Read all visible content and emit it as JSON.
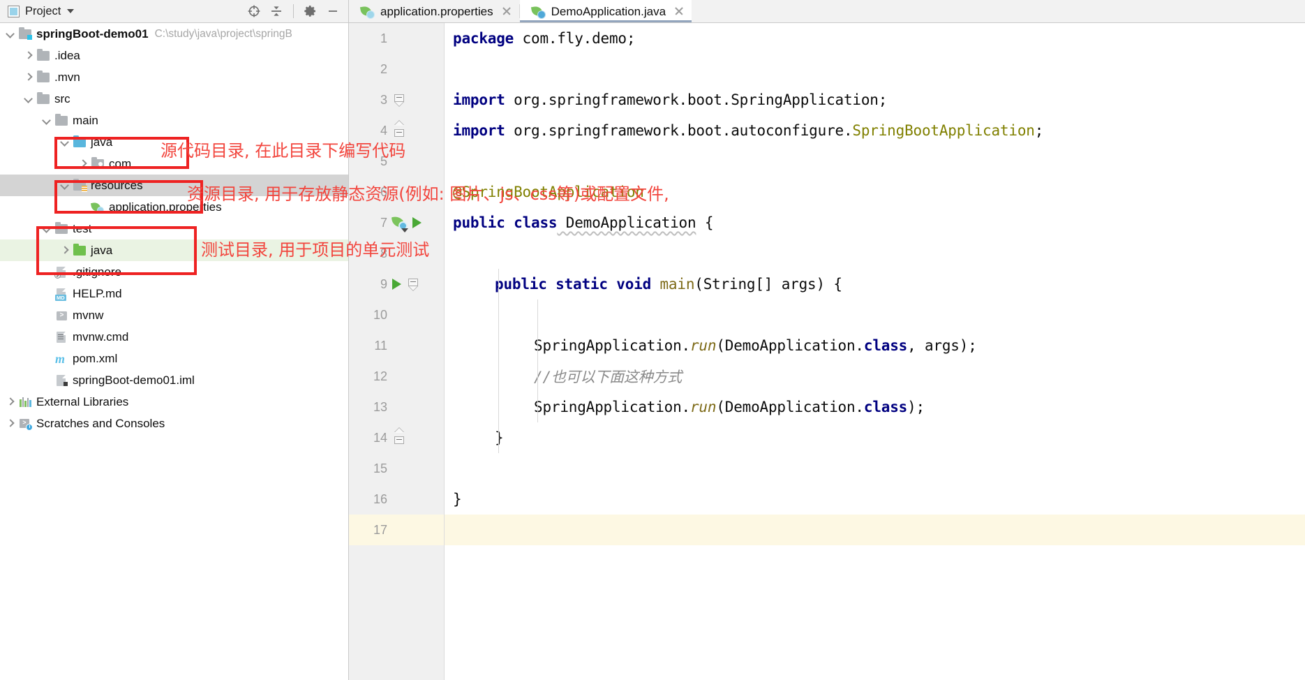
{
  "toolbar": {
    "title": "Project",
    "icons": {
      "project": "project-window-icon",
      "caret": "chevron-down-icon",
      "locate": "locate-target-icon",
      "collapse": "collapse-all-icon",
      "settings": "gear-icon",
      "hide": "minimize-icon"
    }
  },
  "tree": [
    {
      "indent": 0,
      "arrow": "down",
      "icon": "folder-module",
      "label": "springBoot-demo01",
      "bold": true,
      "path": "C:\\study\\java\\project\\springB",
      "state": "normal"
    },
    {
      "indent": 1,
      "arrow": "right",
      "icon": "folder-gray",
      "label": ".idea",
      "bold": false,
      "path": "",
      "state": "normal"
    },
    {
      "indent": 1,
      "arrow": "right",
      "icon": "folder-gray",
      "label": ".mvn",
      "bold": false,
      "path": "",
      "state": "normal"
    },
    {
      "indent": 1,
      "arrow": "down",
      "icon": "folder-gray",
      "label": "src",
      "bold": false,
      "path": "",
      "state": "normal"
    },
    {
      "indent": 2,
      "arrow": "down",
      "icon": "folder-gray",
      "label": "main",
      "bold": false,
      "path": "",
      "state": "normal"
    },
    {
      "indent": 3,
      "arrow": "down",
      "icon": "folder-source",
      "label": "java",
      "bold": false,
      "path": "",
      "state": "normal"
    },
    {
      "indent": 4,
      "arrow": "right",
      "icon": "folder-pkg",
      "label": "com",
      "bold": false,
      "path": "",
      "state": "normal"
    },
    {
      "indent": 3,
      "arrow": "down",
      "icon": "folder-res",
      "label": "resources",
      "bold": false,
      "path": "",
      "state": "selected"
    },
    {
      "indent": 4,
      "arrow": "none",
      "icon": "spring-file",
      "label": "application.properties",
      "bold": false,
      "path": "",
      "state": "normal"
    },
    {
      "indent": 2,
      "arrow": "down",
      "icon": "folder-gray",
      "label": "test",
      "bold": false,
      "path": "",
      "state": "normal"
    },
    {
      "indent": 3,
      "arrow": "right",
      "icon": "folder-test",
      "label": "java",
      "bold": false,
      "path": "",
      "state": "test-highlight"
    },
    {
      "indent": 2,
      "arrow": "none",
      "icon": "file-gitignore",
      "label": ".gitignore",
      "bold": false,
      "path": "",
      "state": "normal"
    },
    {
      "indent": 2,
      "arrow": "none",
      "icon": "file-md",
      "label": "HELP.md",
      "bold": false,
      "path": "",
      "state": "normal"
    },
    {
      "indent": 2,
      "arrow": "none",
      "icon": "file-sh",
      "label": "mvnw",
      "bold": false,
      "path": "",
      "state": "normal"
    },
    {
      "indent": 2,
      "arrow": "none",
      "icon": "file-cmd",
      "label": "mvnw.cmd",
      "bold": false,
      "path": "",
      "state": "normal"
    },
    {
      "indent": 2,
      "arrow": "none",
      "icon": "file-maven",
      "label": "pom.xml",
      "bold": false,
      "path": "",
      "state": "normal"
    },
    {
      "indent": 2,
      "arrow": "none",
      "icon": "file-iml",
      "label": "springBoot-demo01.iml",
      "bold": false,
      "path": "",
      "state": "normal"
    },
    {
      "indent": 0,
      "arrow": "right",
      "icon": "libraries",
      "label": "External Libraries",
      "bold": false,
      "path": "",
      "state": "normal"
    },
    {
      "indent": 0,
      "arrow": "right",
      "icon": "scratches",
      "label": "Scratches and Consoles",
      "bold": false,
      "path": "",
      "state": "normal"
    }
  ],
  "tabs": [
    {
      "label": "application.properties",
      "icon": "spring-properties-icon",
      "active": false,
      "close": "close-icon"
    },
    {
      "label": "DemoApplication.java",
      "icon": "spring-class-icon",
      "active": true,
      "close": "close-icon"
    }
  ],
  "editor": {
    "caret_line": 17,
    "lines": [
      {
        "n": 1,
        "gutter": [],
        "fold": null
      },
      {
        "n": 2,
        "gutter": [],
        "fold": null
      },
      {
        "n": 3,
        "gutter": [],
        "fold": "collapse-down"
      },
      {
        "n": 4,
        "gutter": [],
        "fold": "collapse-up"
      },
      {
        "n": 5,
        "gutter": [],
        "fold": null
      },
      {
        "n": 6,
        "gutter": [],
        "fold": null
      },
      {
        "n": 7,
        "gutter": [
          "spring-bean-icon",
          "run-icon"
        ],
        "fold": null
      },
      {
        "n": 8,
        "gutter": [],
        "fold": null
      },
      {
        "n": 9,
        "gutter": [
          "run-icon"
        ],
        "fold": "collapse-down"
      },
      {
        "n": 10,
        "gutter": [],
        "fold": null
      },
      {
        "n": 11,
        "gutter": [],
        "fold": null
      },
      {
        "n": 12,
        "gutter": [],
        "fold": null
      },
      {
        "n": 13,
        "gutter": [],
        "fold": null
      },
      {
        "n": 14,
        "gutter": [],
        "fold": "collapse-up"
      },
      {
        "n": 15,
        "gutter": [],
        "fold": null
      },
      {
        "n": 16,
        "gutter": [],
        "fold": null
      },
      {
        "n": 17,
        "gutter": [],
        "fold": null
      }
    ],
    "code": {
      "l1": "package com.fly.demo;",
      "l3": "import org.springframework.boot.SpringApplication;",
      "l4": "import org.springframework.boot.autoconfigure.SpringBootApplication;",
      "l6": "@SpringBootApplication",
      "l7": "public class DemoApplication {",
      "l9": "public static void main(String[] args) {",
      "l11": "SpringApplication.run(DemoApplication.class, args);",
      "l12": "//也可以下面这种方式",
      "l13": "SpringApplication.run(DemoApplication.class);",
      "l14": "}",
      "l16": "}"
    },
    "tokens": {
      "kw_package": "package",
      "kw_import": "import",
      "kw_public": "public",
      "kw_class": "class",
      "kw_static": "static",
      "kw_void": "void",
      "pkg_name": " com.fly.demo;",
      "imp1": " org.springframework.boot.SpringApplication;",
      "imp2a": " org.springframework.boot.autoconfigure.",
      "imp2b": "SpringBootApplication",
      "imp2c": ";",
      "ann6": "@SpringBootApplication",
      "cls7": " DemoApplication",
      "brace7": " {",
      "main9": "main",
      "args9": "(String[] args)",
      "brace9": " {",
      "sa11a": "SpringApplication.",
      "sa11b": "run",
      "sa11c": "(DemoApplication.",
      "sa11d": "class",
      "sa11e": ", args",
      "sa11f": ")",
      "sa11g": ";",
      "sa13c": "(DemoApplication.",
      "sa13e": ")",
      "sa13g": ";"
    }
  },
  "annotations": [
    {
      "text": "源代码目录, 在此目录下编写代码",
      "target": "java-source-folder"
    },
    {
      "text": "资源目录, 用于存放静态资源(例如: 图片、js、css等)或配置文件,",
      "target": "resources-folder"
    },
    {
      "text": "测试目录, 用于项目的单元测试",
      "target": "test-java-folder"
    }
  ],
  "colors": {
    "accent_blue": "#4a90d9",
    "annotation_red": "#f2453d",
    "box_red": "#ee2222",
    "keyword": "#000080",
    "annotation_token": "#808000",
    "method": "#7d6a17",
    "comment": "#8a8a8a",
    "caret_line_bg": "#fdf8e3",
    "selection_bg": "#d4d4d4",
    "test_root_bg": "#eaf3e3"
  }
}
